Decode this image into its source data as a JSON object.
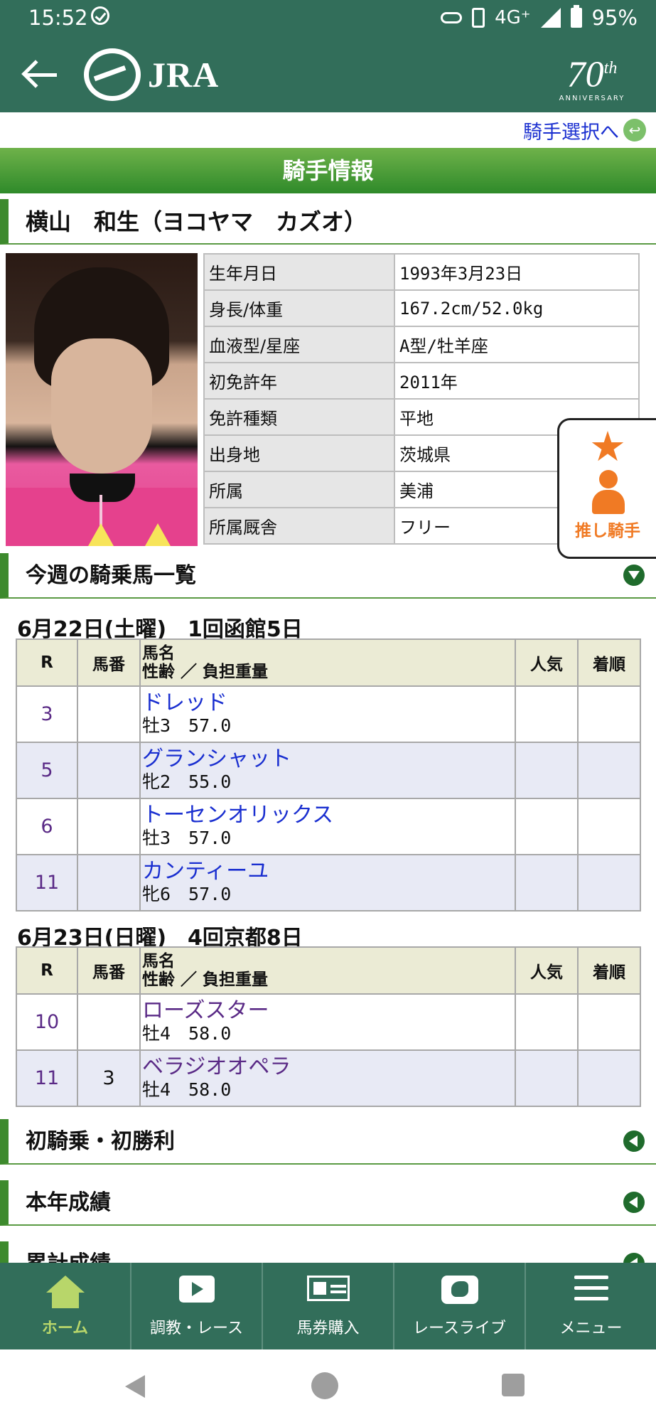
{
  "status_bar": {
    "time": "15:52",
    "network": "4G⁺",
    "battery": "95%"
  },
  "header": {
    "brand": "JRA",
    "anniversary_number": "70",
    "anniversary_suffix": "th",
    "anniversary_text": "ANNIVERSARY"
  },
  "select_link": "騎手選択へ",
  "section_title": "騎手情報",
  "jockey": {
    "name": "横山　和生（ヨコヤマ　カズオ）",
    "info": [
      {
        "key": "生年月日",
        "value": "1993年3月23日"
      },
      {
        "key": "身長/体重",
        "value": "167.2cm/52.0kg"
      },
      {
        "key": "血液型/星座",
        "value": "A型/牡羊座"
      },
      {
        "key": "初免許年",
        "value": "2011年"
      },
      {
        "key": "免許種類",
        "value": "平地"
      },
      {
        "key": "出身地",
        "value": "茨城県"
      },
      {
        "key": "所属",
        "value": "美浦"
      },
      {
        "key": "所属厩舎",
        "value": "フリー"
      }
    ]
  },
  "oshi_label": "推し騎手",
  "weekly": {
    "title": "今週の騎乗馬一覧",
    "columns": {
      "r": "R",
      "no": "馬番",
      "name_line1": "馬名",
      "name_line2": "性齢 ／ 負担重量",
      "pop": "人気",
      "finish": "着順"
    },
    "days": [
      {
        "heading": "6月22日(土曜)　1回函館5日",
        "races": [
          {
            "r": "3",
            "no": "",
            "horse": "ドレッド",
            "sex_weight": "牡3　57.0"
          },
          {
            "r": "5",
            "no": "",
            "horse": "グランシャット",
            "sex_weight": "牝2　55.0"
          },
          {
            "r": "6",
            "no": "",
            "horse": "トーセンオリックス",
            "sex_weight": "牡3　57.0"
          },
          {
            "r": "11",
            "no": "",
            "horse": "カンティーユ",
            "sex_weight": "牝6　57.0"
          }
        ]
      },
      {
        "heading": "6月23日(日曜)　4回京都8日",
        "races": [
          {
            "r": "10",
            "no": "",
            "horse": "ローズスター",
            "sex_weight": "牡4　58.0"
          },
          {
            "r": "11",
            "no": "3",
            "horse": "ベラジオオペラ",
            "sex_weight": "牡4　58.0"
          }
        ]
      }
    ]
  },
  "sections": {
    "first_win": "初騎乗・初勝利",
    "this_year": "本年成績",
    "cumulative": "累計成績"
  },
  "bottom_nav": [
    {
      "label": "ホーム"
    },
    {
      "label": "調教・レース"
    },
    {
      "label": "馬券購入"
    },
    {
      "label": "レースライブ"
    },
    {
      "label": "メニュー"
    }
  ]
}
